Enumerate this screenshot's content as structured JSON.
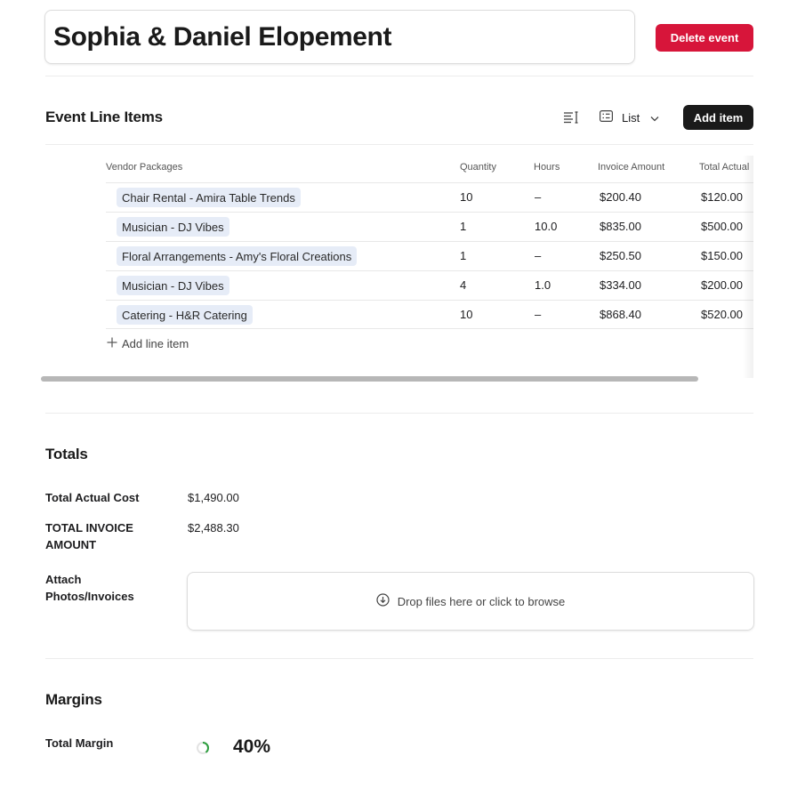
{
  "event": {
    "title": "Sophia & Daniel Elopement",
    "delete_label": "Delete event"
  },
  "line_items": {
    "section_title": "Event Line Items",
    "view_select": {
      "icon": "list-view-icon",
      "label": "List"
    },
    "add_item_label": "Add item",
    "columns": [
      "Vendor Packages",
      "Quantity",
      "Hours",
      "Invoice Amount",
      "Total Actual"
    ],
    "rows": [
      {
        "package": "Chair Rental - Amira Table Trends",
        "quantity": "10",
        "hours": "–",
        "invoice": "$200.40",
        "actual": "$120.00"
      },
      {
        "package": "Musician - DJ Vibes",
        "quantity": "1",
        "hours": "10.0",
        "invoice": "$835.00",
        "actual": "$500.00"
      },
      {
        "package": "Floral Arrangements - Amy's Floral Creations",
        "quantity": "1",
        "hours": "–",
        "invoice": "$250.50",
        "actual": "$150.00"
      },
      {
        "package": "Musician - DJ Vibes",
        "quantity": "4",
        "hours": "1.0",
        "invoice": "$334.00",
        "actual": "$200.00"
      },
      {
        "package": "Catering - H&R Catering",
        "quantity": "10",
        "hours": "–",
        "invoice": "$868.40",
        "actual": "$520.00"
      }
    ],
    "add_line_label": "Add line item"
  },
  "totals": {
    "section_title": "Totals",
    "actual_cost_label": "Total Actual Cost",
    "actual_cost_value": "$1,490.00",
    "invoice_label": "TOTAL INVOICE AMOUNT",
    "invoice_value": "$2,488.30",
    "attach_label": "Attach Photos/Invoices",
    "dropzone_label": "Drop files here or click to browse"
  },
  "margins": {
    "section_title": "Margins",
    "total_margin_label": "Total Margin",
    "total_margin_value": "40%",
    "total_margin_fraction": 0.4,
    "ring_color": "#2e9e3f"
  },
  "colors": {
    "danger": "#d7153a",
    "primary_dark": "#1a1a1a",
    "chip_bg": "#e6ecf7"
  }
}
